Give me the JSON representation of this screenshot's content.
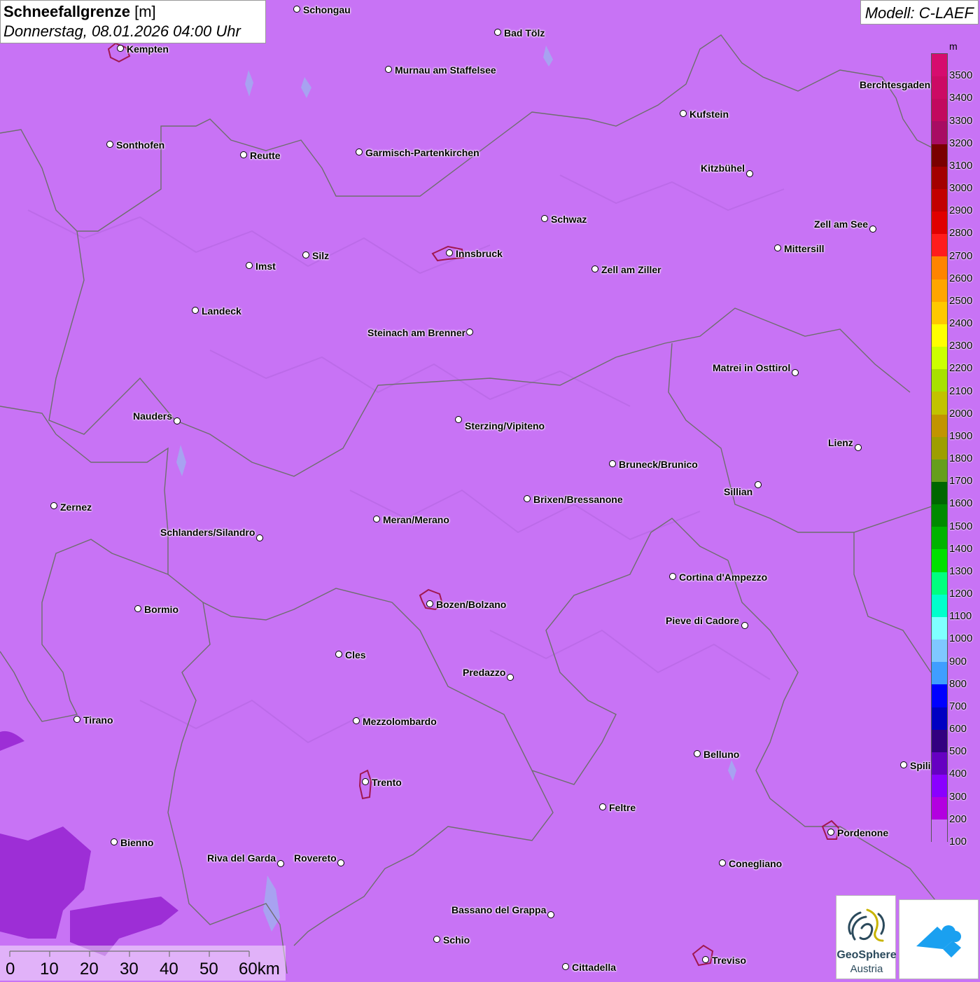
{
  "header": {
    "title_bold": "Schneefallgrenze",
    "title_unit": "[m]",
    "datetime": "Donnerstag, 08.01.2026 04:00 Uhr",
    "model": "Modell: C-LAEF"
  },
  "legend": {
    "unit": "m",
    "levels": [
      "3500",
      "3400",
      "3300",
      "3200",
      "3100",
      "3000",
      "2900",
      "2800",
      "2700",
      "2600",
      "2500",
      "2400",
      "2300",
      "2200",
      "2100",
      "2000",
      "1900",
      "1800",
      "1700",
      "1600",
      "1500",
      "1400",
      "1300",
      "1200",
      "1100",
      "1000",
      "900",
      "800",
      "700",
      "600",
      "500",
      "400",
      "300",
      "200",
      "100"
    ],
    "colors": [
      "#d60c6e",
      "#cc0a64",
      "#c2095e",
      "#a80c63",
      "#7a0000",
      "#a30000",
      "#c20000",
      "#e00000",
      "#ff1c1c",
      "#ff8400",
      "#ffa500",
      "#ffc800",
      "#ffff00",
      "#ccff00",
      "#a8e000",
      "#c2c200",
      "#c29400",
      "#9e9e00",
      "#669e1c",
      "#006600",
      "#008a00",
      "#00b300",
      "#00e000",
      "#00ff7f",
      "#00ffcc",
      "#7fffff",
      "#7fc8ff",
      "#3f9eff",
      "#0000ff",
      "#0000c2",
      "#330080",
      "#6600c2",
      "#8a00ff",
      "#b300e0",
      "#c873f5"
    ]
  },
  "cities": [
    {
      "name": "Schongau"
    },
    {
      "name": "Bad Tölz"
    },
    {
      "name": "Kempten"
    },
    {
      "name": "Murnau am Staffelsee"
    },
    {
      "name": "Berchtesgaden"
    },
    {
      "name": "Kufstein"
    },
    {
      "name": "Sonthofen"
    },
    {
      "name": "Reutte"
    },
    {
      "name": "Garmisch-Partenkirchen"
    },
    {
      "name": "Kitzbühel"
    },
    {
      "name": "Schwaz"
    },
    {
      "name": "Zell am See"
    },
    {
      "name": "Mittersill"
    },
    {
      "name": "Innsbruck"
    },
    {
      "name": "Silz"
    },
    {
      "name": "Imst"
    },
    {
      "name": "Zell am Ziller"
    },
    {
      "name": "Landeck"
    },
    {
      "name": "Steinach am Brenner"
    },
    {
      "name": "Matrei in Osttirol"
    },
    {
      "name": "Nauders"
    },
    {
      "name": "Sterzing/Vipiteno"
    },
    {
      "name": "Lienz"
    },
    {
      "name": "Bruneck/Brunico"
    },
    {
      "name": "Sillian"
    },
    {
      "name": "Zernez"
    },
    {
      "name": "Brixen/Bressanone"
    },
    {
      "name": "Meran/Merano"
    },
    {
      "name": "Schlanders/Silandro"
    },
    {
      "name": "Cortina d'Ampezzo"
    },
    {
      "name": "Bormio"
    },
    {
      "name": "Bozen/Bolzano"
    },
    {
      "name": "Pieve di Cadore"
    },
    {
      "name": "Cles"
    },
    {
      "name": "Predazzo"
    },
    {
      "name": "Tirano"
    },
    {
      "name": "Mezzolombardo"
    },
    {
      "name": "Belluno"
    },
    {
      "name": "Spili"
    },
    {
      "name": "Trento"
    },
    {
      "name": "Feltre"
    },
    {
      "name": "Pordenone"
    },
    {
      "name": "Bienno"
    },
    {
      "name": "Riva del Garda"
    },
    {
      "name": "Rovereto"
    },
    {
      "name": "Conegliano"
    },
    {
      "name": "Bassano del Grappa"
    },
    {
      "name": "Schio"
    },
    {
      "name": "Treviso"
    },
    {
      "name": "Cittadella"
    }
  ],
  "scale": {
    "labels": [
      "0",
      "10",
      "20",
      "30",
      "40",
      "50",
      "60km"
    ]
  },
  "logo": {
    "name_line1": "GeoSphere",
    "name_line2": "Austria"
  }
}
